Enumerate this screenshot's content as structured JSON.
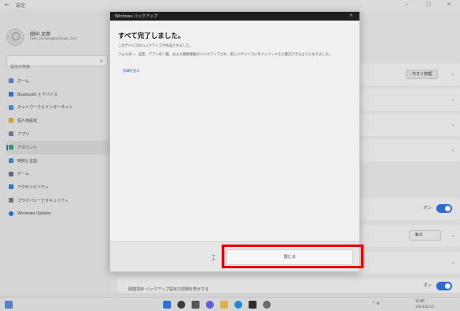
{
  "window": {
    "back": "←",
    "title": "設定",
    "controls": [
      "–",
      "□",
      "×"
    ]
  },
  "profile": {
    "name": "田中 太郎",
    "email": "taro_tanaka@outlook.com"
  },
  "search": {
    "placeholder": "設定の検索"
  },
  "nav": [
    {
      "label": "ホーム",
      "color": "#5a7fc4"
    },
    {
      "label": "Bluetooth とデバイス",
      "color": "#3d6fd6"
    },
    {
      "label": "ネットワークとインターネット",
      "color": "#4f88d8"
    },
    {
      "label": "個人用設定",
      "color": "#d9a23c"
    },
    {
      "label": "アプリ",
      "color": "#7a7a9a"
    },
    {
      "label": "アカウント",
      "color": "#3aa06a",
      "active": true
    },
    {
      "label": "時刻と言語",
      "color": "#4b7fd0"
    },
    {
      "label": "ゲーム",
      "color": "#6b6b8b"
    },
    {
      "label": "アクセシビリティ",
      "color": "#3a78c8"
    },
    {
      "label": "プライバシーとセキュリティ",
      "color": "#7a7a7a"
    },
    {
      "label": "Windows Update",
      "color": "#2f6fe0"
    }
  ],
  "main": {
    "rows": [
      {
        "button": "今すぐ管理"
      },
      {},
      {},
      {},
      {
        "toggle_label": "オン"
      },
      {
        "dropdown": "毎日"
      },
      {},
      {
        "toggle_label": "オン"
      }
    ],
    "footer_text": "関連項目 バックアップ設定の詳細を表示する"
  },
  "dialog": {
    "title": "Windows バックアップ",
    "close_x": "×",
    "heading": "すべて完了しました。",
    "line1": "このデバイスのバックアップが作成されました。",
    "paragraph": "フォルダー、設定、アプリの一覧、および資格情報がバックアップされ、新しいデバイスにサインインすると復元できるようになりました。",
    "link": "詳細を見る",
    "close_button": "閉じる"
  },
  "taskbar": {
    "icons": [
      {
        "name": "windows-start-icon",
        "color": "#2f6fe0"
      },
      {
        "name": "search-taskbar-icon",
        "color": "#3a3a3a"
      },
      {
        "name": "task-view-icon",
        "color": "#555"
      },
      {
        "name": "chat-icon",
        "color": "#5d5fe0"
      },
      {
        "name": "file-explorer-icon",
        "color": "#e0b23a"
      },
      {
        "name": "edge-icon",
        "color": "#1f8ad8"
      },
      {
        "name": "store-icon",
        "color": "#2d2d2d"
      },
      {
        "name": "settings-taskbar-icon",
        "color": "#6a6a6a"
      }
    ],
    "tray_text": "^ A",
    "time": "9:00",
    "date": "2024/01/15"
  },
  "accent": "#2f6fe0",
  "highlight_color": "#e60000"
}
